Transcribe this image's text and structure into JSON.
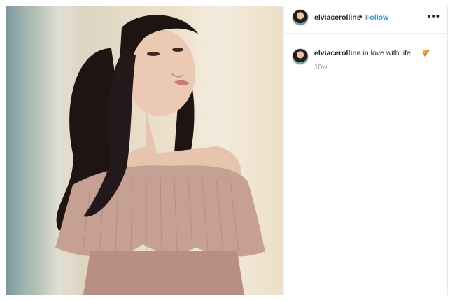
{
  "post": {
    "photo": {
      "icon": "woman-portrait-photo"
    },
    "header": {
      "username": "elviacerolline",
      "separator": "•",
      "follow_label": "Follow",
      "more_icon": "ellipsis-icon",
      "more_label": "•••"
    },
    "caption": {
      "username": "elviacerolline",
      "text": "in love with life ...",
      "emoji_icon": "pizza-icon",
      "timestamp": "10w"
    }
  },
  "colors": {
    "follow": "#3897f0",
    "text": "#262626",
    "muted": "#8e8e8e",
    "border": "#efefef"
  }
}
